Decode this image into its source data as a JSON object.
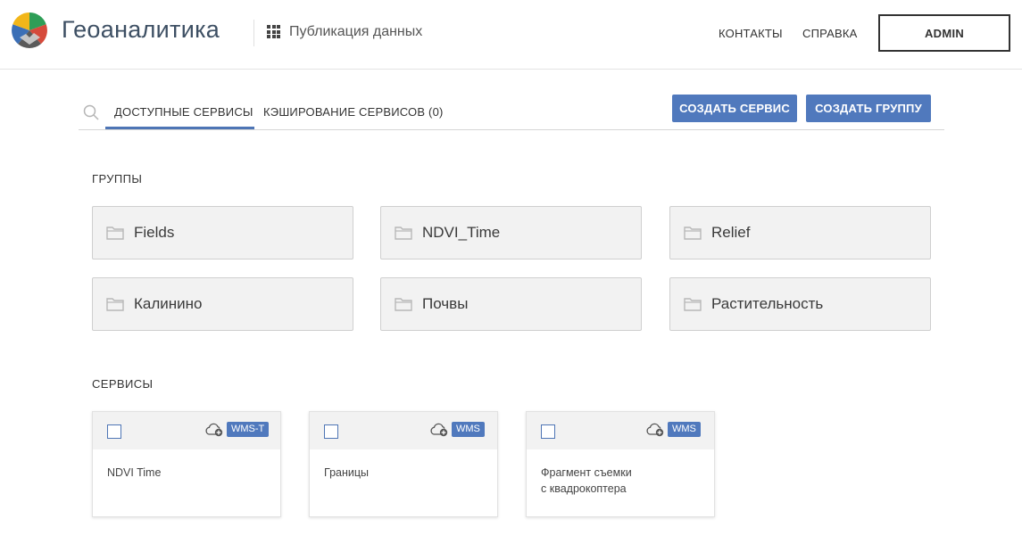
{
  "header": {
    "brand": "Геоаналитика",
    "section_title": "Публикация данных",
    "nav": {
      "contacts": "КОНТАКТЫ",
      "help": "СПРАВКА"
    },
    "user_button": "ADMIN"
  },
  "tabs": {
    "available": "ДОСТУПНЫЕ СЕРВИСЫ",
    "caching": "КЭШИРОВАНИЕ СЕРВИСОВ (0)",
    "create_service": "СОЗДАТЬ СЕРВИС",
    "create_group": "СОЗДАТЬ ГРУППУ"
  },
  "groups": {
    "heading": "ГРУППЫ",
    "items": [
      "Fields",
      "NDVI_Time",
      "Relief",
      "Калинино",
      "Почвы",
      "Растительность"
    ]
  },
  "services": {
    "heading": "СЕРВИСЫ",
    "items": [
      {
        "name": "NDVI Time",
        "badge": "WMS-T"
      },
      {
        "name": "Границы",
        "badge": "WMS"
      },
      {
        "name": "Фрагмент съемки\nс квадрокоптера",
        "badge": "WMS"
      }
    ]
  },
  "colors": {
    "accent": "#5079bd",
    "brand_text": "#3d4f63"
  }
}
